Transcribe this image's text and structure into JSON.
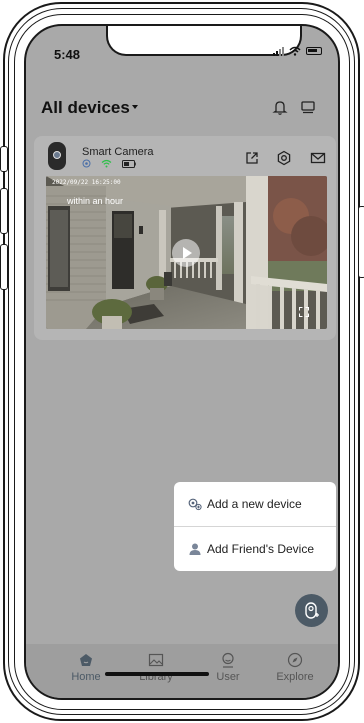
{
  "status_bar": {
    "time": "5:48"
  },
  "header": {
    "title": "All devices"
  },
  "device_card": {
    "name": "Smart Camera",
    "video_timestamp": "2022/09/22 16:25:00",
    "video_label": "within an hour"
  },
  "popup_menu": {
    "items": [
      {
        "label": "Add a new device",
        "icon": "camera-add-icon"
      },
      {
        "label": "Add Friend's Device",
        "icon": "person-icon"
      }
    ]
  },
  "tab_bar": {
    "items": [
      {
        "label": "Home",
        "icon": "home-icon",
        "active": true
      },
      {
        "label": "Library",
        "icon": "image-icon",
        "active": false
      },
      {
        "label": "User",
        "icon": "user-icon",
        "active": false
      },
      {
        "label": "Explore",
        "icon": "compass-icon",
        "active": false
      }
    ]
  },
  "colors": {
    "overlay": "#a9a9a9",
    "card": "#b5b5b5",
    "accent": "#4c5a66",
    "wifi_green": "#2fbf4a"
  }
}
